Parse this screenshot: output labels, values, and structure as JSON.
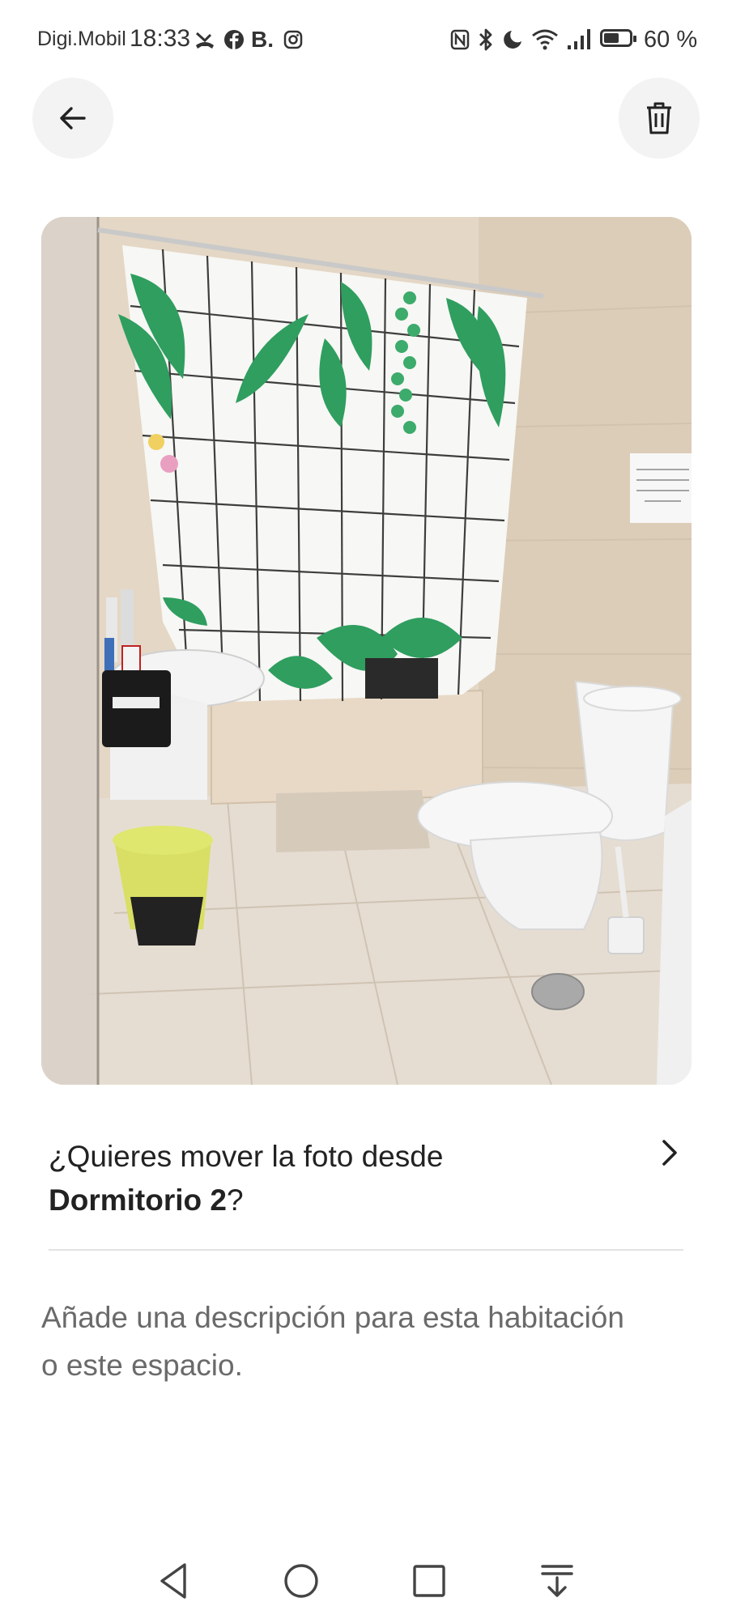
{
  "status_bar": {
    "carrier": "Digi.Mobil",
    "time": "18:33",
    "notification_icons": [
      "missed-call-icon",
      "facebook-icon",
      "b-app-icon",
      "instagram-icon"
    ],
    "system_icons": [
      "nfc-icon",
      "bluetooth-icon",
      "do-not-disturb-icon",
      "wifi-icon",
      "signal-icon"
    ],
    "battery_level": 0.6,
    "battery_text": "60 %"
  },
  "header": {
    "back_icon": "arrow-left-icon",
    "delete_icon": "trash-icon"
  },
  "photo": {
    "subject": "bathroom-photo"
  },
  "move_prompt": {
    "text_prefix": "¿Quieres mover la foto desde",
    "room_name": "Dormitorio 2",
    "text_suffix": "?"
  },
  "description": {
    "placeholder": "Añade una descripción para esta habitación o este espacio."
  },
  "nav_bar": {
    "icons": [
      "back-triangle-icon",
      "home-circle-icon",
      "recents-square-icon",
      "notification-pull-icon"
    ]
  }
}
